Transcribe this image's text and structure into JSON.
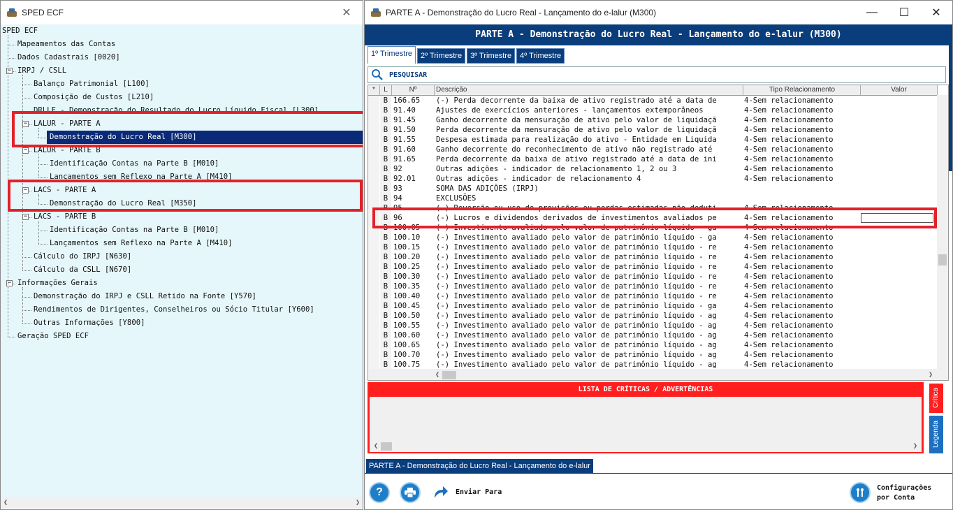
{
  "left_window": {
    "title": "SPED ECF",
    "tree": [
      {
        "label": "SPED ECF"
      },
      {
        "label": "Mapeamentos das Contas"
      },
      {
        "label": "Dados Cadastrais [0020]"
      },
      {
        "label": "IRPJ / CSLL"
      },
      {
        "label": "Balanço Patrimonial [L100]"
      },
      {
        "label": "Composição de Custos [L210]"
      },
      {
        "label": "DRLLF - Demonstração do Resultado do Lucro Líquido Fiscal [L300]"
      },
      {
        "label": "LALUR - PARTE A"
      },
      {
        "label": "Demonstração do Lucro Real [M300]"
      },
      {
        "label": "LALUR - PARTE B"
      },
      {
        "label": "Identificação Contas na Parte B [M010]"
      },
      {
        "label": "Lançamentos sem Reflexo na Parte A [M410]"
      },
      {
        "label": "LACS - PARTE A"
      },
      {
        "label": "Demonstração do Lucro Real [M350]"
      },
      {
        "label": "LACS - PARTE B"
      },
      {
        "label": "Identificação Contas na Parte B [M010]"
      },
      {
        "label": "Lançamentos sem Reflexo na Parte A [M410]"
      },
      {
        "label": "Cálculo do IRPJ [N630]"
      },
      {
        "label": "Cálculo da CSLL [N670]"
      },
      {
        "label": "Informações Gerais"
      },
      {
        "label": "Demonstração do IRPJ e CSLL Retido na Fonte [Y570]"
      },
      {
        "label": "Rendimentos de Dirigentes, Conselheiros ou Sócio Titular [Y600]"
      },
      {
        "label": "Outras Informações [Y800]"
      },
      {
        "label": "Geração SPED ECF"
      }
    ]
  },
  "right_window": {
    "title": "PARTE A - Demonstração do Lucro Real - Lançamento do e-lalur (M300)",
    "header": "PARTE A - Demonstração do Lucro Real - Lançamento do e-lalur (M300)",
    "tabs": [
      "1º Trimestre",
      "2º Trimestre",
      "3º Trimestre",
      "4º Trimestre"
    ],
    "search_label": "PESQUISAR",
    "columns": [
      "*",
      "L",
      "Nº",
      "Descrição",
      "Tipo Relacionamento",
      "Valor"
    ],
    "rows": [
      {
        "l": "B",
        "n": "166.65",
        "d": "(-) Perda decorrente da baixa de ativo registrado até a data de",
        "t": "4-Sem relacionamento"
      },
      {
        "l": "B",
        "n": "91.40",
        "d": "Ajustes de exercícios anteriores - lançamentos extemporâneos",
        "t": "4-Sem relacionamento"
      },
      {
        "l": "B",
        "n": "91.45",
        "d": "Ganho decorrente da mensuração de ativo pelo valor de liquidaçã",
        "t": "4-Sem relacionamento"
      },
      {
        "l": "B",
        "n": "91.50",
        "d": "Perda decorrente da mensuração de ativo pelo valor de liquidaçã",
        "t": "4-Sem relacionamento"
      },
      {
        "l": "B",
        "n": "91.55",
        "d": "Despesa estimada para realização do ativo - Entidade em Liquida",
        "t": "4-Sem relacionamento"
      },
      {
        "l": "B",
        "n": "91.60",
        "d": "Ganho decorrente do reconhecimento de ativo não registrado até",
        "t": "4-Sem relacionamento"
      },
      {
        "l": "B",
        "n": "91.65",
        "d": "Perda decorrente da baixa de ativo registrado até a data de ini",
        "t": "4-Sem relacionamento"
      },
      {
        "l": "B",
        "n": "92",
        "d": "Outras adições - indicador de relacionamento 1, 2 ou 3",
        "t": "4-Sem relacionamento"
      },
      {
        "l": "B",
        "n": "92.01",
        "d": "Outras adições - indicador de relacionamento 4",
        "t": "4-Sem relacionamento"
      },
      {
        "l": "B",
        "n": "93",
        "d": "SOMA DAS ADIÇÕES (IRPJ)",
        "t": ""
      },
      {
        "l": "B",
        "n": "94",
        "d": "EXCLUSÕES",
        "t": ""
      },
      {
        "l": "B",
        "n": "95",
        "d": "(-) Reversão ou uso de provisões ou perdas estimadas não deduti",
        "t": "4-Sem relacionamento"
      },
      {
        "l": "B",
        "n": "96",
        "d": "(-) Lucros e dividendos derivados de investimentos avaliados pe",
        "t": "4-Sem relacionamento"
      },
      {
        "l": "B",
        "n": "100.05",
        "d": "(-) Investimento avaliado pelo valor de patrimônio líquido - ga",
        "t": "4-Sem relacionamento"
      },
      {
        "l": "B",
        "n": "100.10",
        "d": "(-) Investimento avaliado pelo valor de patrimônio líquido - ga",
        "t": "4-Sem relacionamento"
      },
      {
        "l": "B",
        "n": "100.15",
        "d": "(-) Investimento avaliado pelo valor de patrimônio líquido - re",
        "t": "4-Sem relacionamento"
      },
      {
        "l": "B",
        "n": "100.20",
        "d": "(-) Investimento avaliado pelo valor de patrimônio líquido - re",
        "t": "4-Sem relacionamento"
      },
      {
        "l": "B",
        "n": "100.25",
        "d": "(-) Investimento avaliado pelo valor de patrimônio líquido - re",
        "t": "4-Sem relacionamento"
      },
      {
        "l": "B",
        "n": "100.30",
        "d": "(-) Investimento avaliado pelo valor de patrimônio líquido - re",
        "t": "4-Sem relacionamento"
      },
      {
        "l": "B",
        "n": "100.35",
        "d": "(-) Investimento avaliado pelo valor de patrimônio líquido - re",
        "t": "4-Sem relacionamento"
      },
      {
        "l": "B",
        "n": "100.40",
        "d": "(-) Investimento avaliado pelo valor de patrimônio líquido - re",
        "t": "4-Sem relacionamento"
      },
      {
        "l": "B",
        "n": "100.45",
        "d": "(-) Investimento avaliado pelo valor de patrimônio líquido - ga",
        "t": "4-Sem relacionamento"
      },
      {
        "l": "B",
        "n": "100.50",
        "d": "(-) Investimento avaliado pelo valor de patrimônio líquido - ag",
        "t": "4-Sem relacionamento"
      },
      {
        "l": "B",
        "n": "100.55",
        "d": "(-) Investimento avaliado pelo valor de patrimônio líquido - ag",
        "t": "4-Sem relacionamento"
      },
      {
        "l": "B",
        "n": "100.60",
        "d": "(-) Investimento avaliado pelo valor de patrimônio líquido - ag",
        "t": "4-Sem relacionamento"
      },
      {
        "l": "B",
        "n": "100.65",
        "d": "(-) Investimento avaliado pelo valor de patrimônio líquido - ag",
        "t": "4-Sem relacionamento"
      },
      {
        "l": "B",
        "n": "100.70",
        "d": "(-) Investimento avaliado pelo valor de patrimônio líquido - ag",
        "t": "4-Sem relacionamento"
      },
      {
        "l": "B",
        "n": "100.75",
        "d": "(-) Investimento avaliado pelo valor de patrimônio líquido - ag",
        "t": "4-Sem relacionamento"
      }
    ],
    "critics_title": "LISTA DE CRÍTICAS / ADVERTÊNCIAS",
    "side_tabs": [
      "Crítica",
      "Legenda"
    ],
    "bottom_tab": "PARTE A - Demonstração do Lucro Real - Lançamento do e-lalur",
    "send_label": "Enviar Para",
    "config_label_1": "Configurações",
    "config_label_2": "por Conta",
    "help_glyph": "?"
  },
  "colors": {
    "navy": "#0a3d7c",
    "selection": "#0a2a78",
    "highlight_red": "#e3212a",
    "tree_bg": "#e6f7fb"
  }
}
